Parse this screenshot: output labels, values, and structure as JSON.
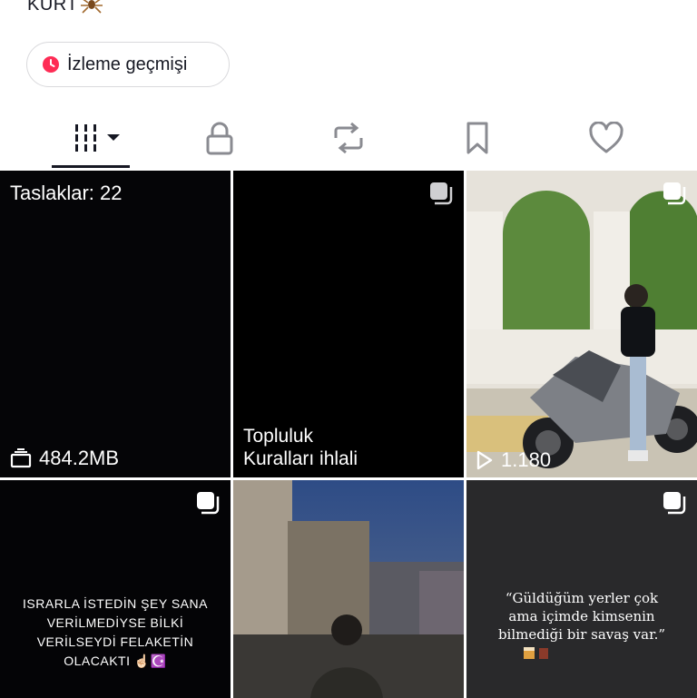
{
  "profile": {
    "name_fragment": "KURT"
  },
  "history_button": {
    "label": "İzleme geçmişi"
  },
  "tabs": [
    {
      "icon": "grid-icon",
      "active": true
    },
    {
      "icon": "lock-icon"
    },
    {
      "icon": "repost-icon"
    },
    {
      "icon": "bookmark-icon"
    },
    {
      "icon": "heart-icon"
    }
  ],
  "grid": {
    "drafts": {
      "label": "Taslaklar: 22",
      "size": "484.2MB"
    },
    "violation": {
      "line1": "Topluluk",
      "line2": "Kuralları ihlali"
    },
    "moto": {
      "views": "1.180"
    },
    "quote1": {
      "line1": "ISRARLA İSTEDİN ŞEY SANA",
      "line2": "VERİLMEDİYSE BİLKİ",
      "line3": "VERİLSEYDİ FELAKETİN",
      "line4": "OLACAKTI ☝🏻☪️"
    },
    "quote2": {
      "line1": "“Güldüğüm yerler çok",
      "line2": "ama içimde kimsenin",
      "line3": "bilmediği bir savaş var.”"
    }
  },
  "colors": {
    "accent": "#fe2c55",
    "text": "#161823",
    "icon_gray": "#8a8b91"
  }
}
